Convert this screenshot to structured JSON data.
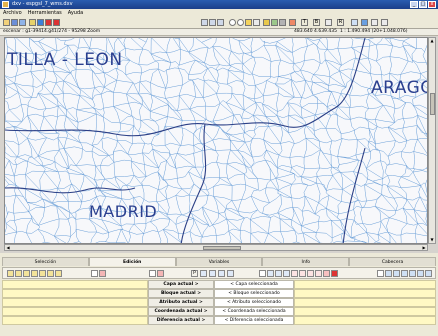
{
  "window": {
    "title": "dxv - espgsl_7_wms.dxv",
    "buttons": [
      "_",
      "□",
      "x"
    ]
  },
  "menu": [
    "Archivo",
    "Herramientas",
    "Ayuda"
  ],
  "status": {
    "left": "escenar : g1-39414.g41/274 - 95298 Zoom",
    "coords": "483.640  4.639.435",
    "scale": "1 : 1.490.494 (20+1.048.076)"
  },
  "map": {
    "labels": [
      "TILLA - LEON",
      "ARAGO",
      "MADRID"
    ],
    "colors": {
      "fine": "#6a9fd8",
      "bold": "#2b3f86",
      "label": "#2a3f8f",
      "bg": "#f7f8fb"
    }
  },
  "panel": {
    "tabs": [
      "Selección",
      "Edición",
      "Variables",
      "Info",
      "Cabecera"
    ],
    "active_tab": "Edición",
    "rows": [
      {
        "label": "Capa actual >",
        "value": "< Capa seleccionada"
      },
      {
        "label": "Bloque actual >",
        "value": "< Bloque seleccionado"
      },
      {
        "label": "Atributo actual >",
        "value": "< Atributo seleccionado"
      },
      {
        "label": "Coordenada actual >",
        "value": "< Coordenada seleccionada"
      },
      {
        "label": "Diferencia actual >",
        "value": "< Diferencia seleccionada"
      }
    ],
    "tool_glyphs": {
      "text_tools": "P",
      "type_tools": "T",
      "block_tools": "B",
      "ruler_tools": "R"
    }
  }
}
